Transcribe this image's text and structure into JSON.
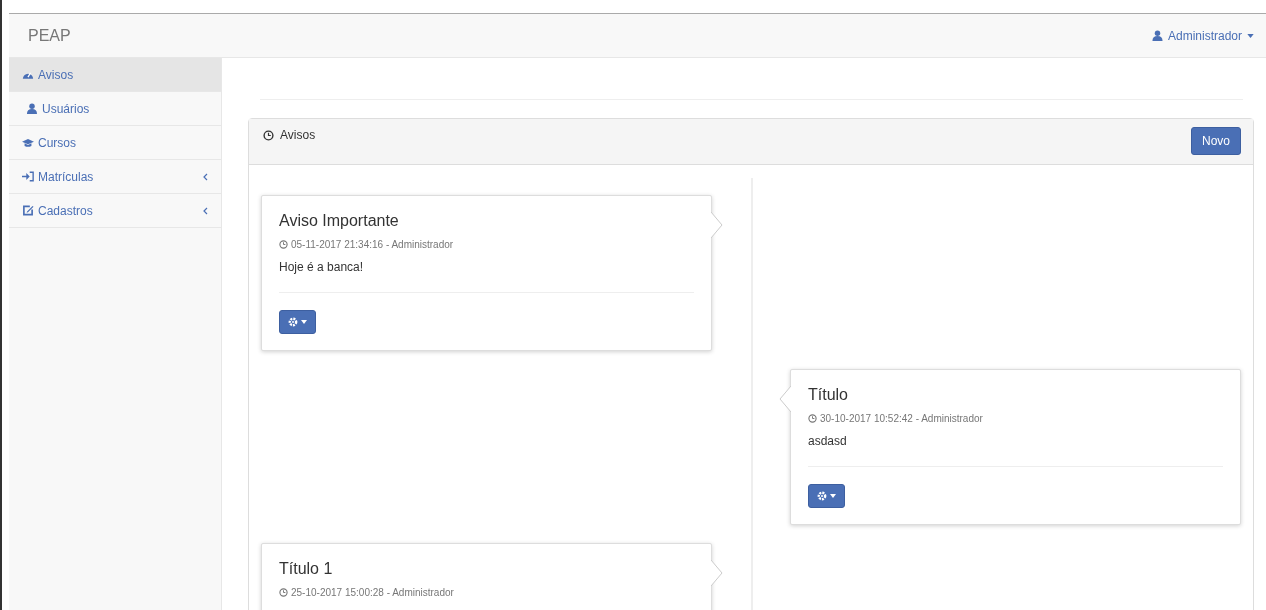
{
  "navbar": {
    "brand": "PEAP",
    "user": "Administrador"
  },
  "sidebar": {
    "items": [
      {
        "label": "Avisos",
        "selected": true,
        "expandable": false
      },
      {
        "label": "Usuários",
        "selected": false,
        "expandable": false
      },
      {
        "label": "Cursos",
        "selected": false,
        "expandable": false
      },
      {
        "label": "Matrículas",
        "selected": false,
        "expandable": true
      },
      {
        "label": "Cadastros",
        "selected": false,
        "expandable": true
      }
    ]
  },
  "panel": {
    "title": "Avisos",
    "button": "Novo"
  },
  "timeline": [
    {
      "title": "Aviso Importante",
      "meta": "05-11-2017 21:34:16 - Administrador",
      "body": "Hoje é a banca!"
    },
    {
      "title": "Título",
      "meta": "30-10-2017 10:52:42 - Administrador",
      "body": "asdasd"
    },
    {
      "title": "Título 1",
      "meta": "25-10-2017 15:00:28 - Administrador"
    }
  ]
}
